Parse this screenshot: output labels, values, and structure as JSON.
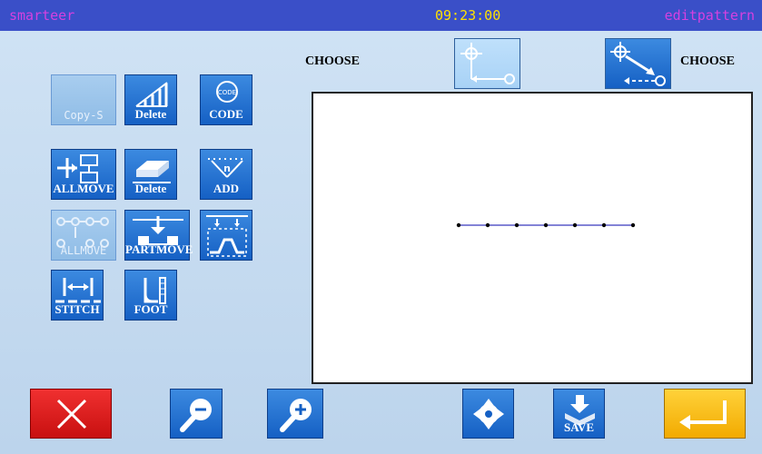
{
  "header": {
    "app_name": "smarteer",
    "time": "09:23:00",
    "mode": "editpattern"
  },
  "choose_labels": {
    "left": "CHOOSE",
    "right": "CHOOSE"
  },
  "tools": {
    "copy_s": "Copy-S",
    "delete_1": "Delete",
    "code": "CODE",
    "allmove_1": "ALLMOVE",
    "delete_2": "Delete",
    "add": "ADD",
    "allmove_2": "ALLMOVE",
    "partmove": "PARTMOVE",
    "stitch": "STITCH",
    "foot": "FOOT"
  },
  "bottom": {
    "save": "SAVE"
  },
  "colors": {
    "header_bg": "#3a4fc8",
    "cancel_red": "#e02020",
    "confirm_yellow": "#f5b800",
    "stitch_line": "#5a5ac8"
  }
}
